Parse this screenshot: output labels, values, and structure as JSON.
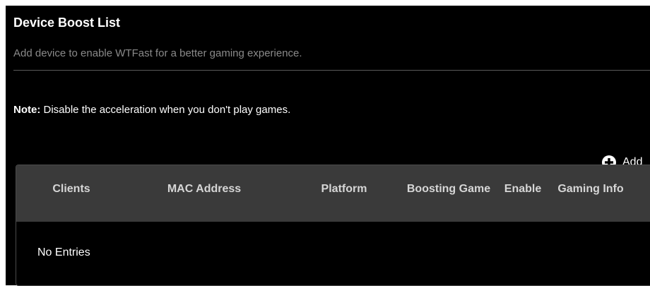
{
  "header": {
    "title": "Device Boost List",
    "subtitle": "Add device to enable WTFast for a better gaming experience."
  },
  "note": {
    "label": "Note:",
    "text": " Disable the acceleration when you don't play games."
  },
  "add_button": {
    "label": "Add",
    "icon": "plus-circle-icon"
  },
  "table": {
    "columns": {
      "clients": "Clients",
      "mac_address": "MAC Address",
      "platform": "Platform",
      "boosting_game": "Boosting Game",
      "enable": "Enable",
      "gaming_info": "Gaming Info"
    },
    "rows": [],
    "empty_text": "No Entries"
  },
  "colors": {
    "background": "#000000",
    "table_header": "#3a3a3a",
    "subtitle_text": "#8a8a8a",
    "text": "#ffffff"
  }
}
